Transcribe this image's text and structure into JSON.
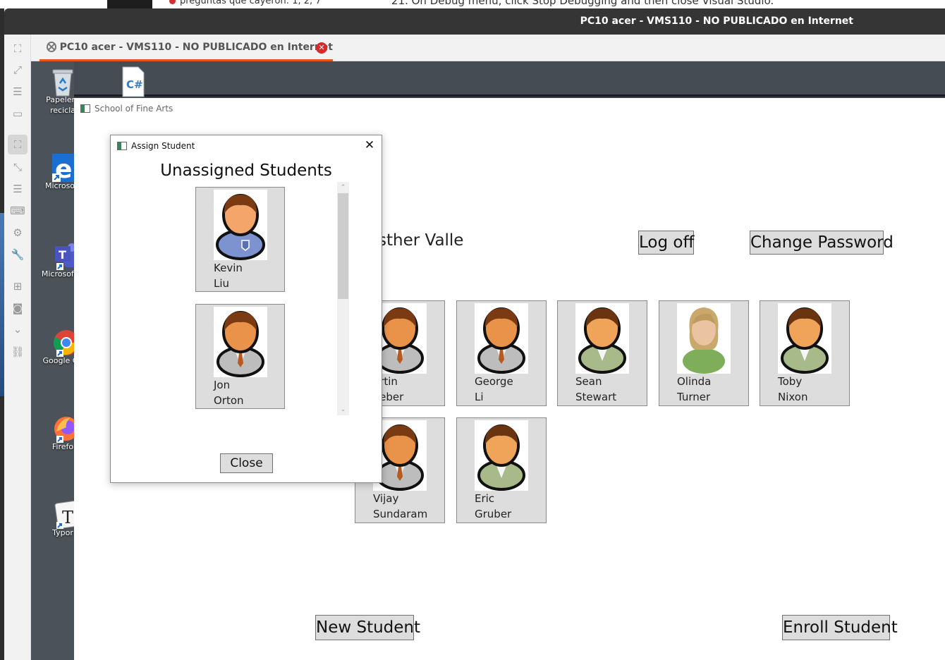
{
  "background": {
    "behind_text_1": "preguntas que cayeron: 1, 2, 7",
    "behind_text_2": "21. On Debug menu, click Stop Debugging and then close Visual Studio."
  },
  "vm": {
    "window_title": "PC10 acer - VMS110 - NO PUBLICADO en Internet",
    "tab_label": "PC10 acer - VMS110 - NO PUBLICADO en Internet",
    "sidebar_icons": [
      "screenshot-icon",
      "fullscreen-icon",
      "menu-icon",
      "window-icon",
      "fit-screen-icon",
      "resize-icon",
      "list-icon",
      "keyboard-icon",
      "settings-icon",
      "wrench-icon",
      "add-window-icon",
      "camera-icon",
      "chevron-down-icon",
      "link-icon"
    ]
  },
  "desktop": {
    "icons": [
      {
        "label_line1": "Papelera",
        "label_line2": "recicla",
        "icon": "recycle-bin-icon"
      },
      {
        "label_line1": "",
        "label_line2": "",
        "icon": "csharp-file-icon"
      },
      {
        "label_line1": "Microsoft",
        "label_line2": "",
        "icon": "edge-icon"
      },
      {
        "label_line1": "Microsoft T",
        "label_line2": "",
        "icon": "teams-icon"
      },
      {
        "label_line1": "Google Ch",
        "label_line2": "",
        "icon": "chrome-icon"
      },
      {
        "label_line1": "Firefo",
        "label_line2": "",
        "icon": "firefox-icon"
      },
      {
        "label_line1": "Typor",
        "label_line2": "",
        "icon": "typora-icon"
      }
    ]
  },
  "app": {
    "title": "School of Fine Arts",
    "welcome_text": "e Esther Valle",
    "buttons": {
      "logoff": "Log off",
      "change_password": "Change Password",
      "new_student": "New Student",
      "enroll_student": "Enroll Student"
    },
    "students": [
      {
        "first": "artin",
        "last": "Veber",
        "avatar": "male-suit"
      },
      {
        "first": "George",
        "last": "Li",
        "avatar": "male-suit"
      },
      {
        "first": "Sean",
        "last": "Stewart",
        "avatar": "male-green"
      },
      {
        "first": "Olinda",
        "last": "Turner",
        "avatar": "female"
      },
      {
        "first": "Toby",
        "last": "Nixon",
        "avatar": "male-green"
      },
      {
        "first": "Vijay",
        "last": "Sundaram",
        "avatar": "male-suit"
      },
      {
        "first": "Eric",
        "last": "Gruber",
        "avatar": "male-green"
      }
    ]
  },
  "dialog": {
    "title": "Assign Student",
    "heading": "Unassigned Students",
    "close_button": "Close",
    "students": [
      {
        "first": "Kevin",
        "last": "Liu",
        "avatar": "male-blue"
      },
      {
        "first": "Jon",
        "last": "Orton",
        "avatar": "male-suit"
      }
    ]
  },
  "colors": {
    "accent": "#e95420",
    "vm_titlebar": "#353535",
    "tile_bg": "#dddddd",
    "close_red": "#d92a2a"
  }
}
